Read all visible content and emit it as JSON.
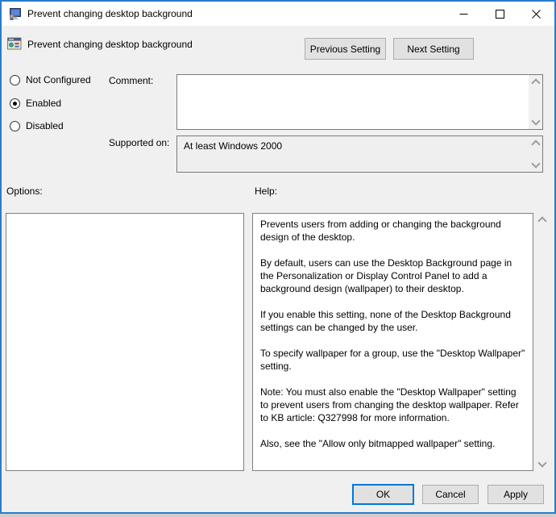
{
  "titlebar": {
    "title": "Prevent changing desktop background"
  },
  "header": {
    "title": "Prevent changing desktop background",
    "previous_button": "Previous Setting",
    "next_button": "Next Setting"
  },
  "state": {
    "not_configured": "Not Configured",
    "enabled": "Enabled",
    "disabled": "Disabled",
    "selected": "Enabled"
  },
  "comment": {
    "label": "Comment:",
    "value": ""
  },
  "supported_on": {
    "label": "Supported on:",
    "value": "At least Windows 2000"
  },
  "options_panel": {
    "label": "Options:"
  },
  "help_panel": {
    "label": "Help:",
    "paragraphs": [
      "Prevents users from adding or changing the background design of the desktop.",
      "By default, users can use the Desktop Background page in the Personalization or Display Control Panel to add a background design (wallpaper) to their desktop.",
      "If you enable this setting, none of the Desktop Background settings can be changed by the user.",
      "To specify wallpaper for a group, use the \"Desktop Wallpaper\" setting.",
      "Note: You must also enable the \"Desktop Wallpaper\" setting to prevent users from changing the desktop wallpaper. Refer to KB article: Q327998 for more information.",
      "Also, see the \"Allow only bitmapped wallpaper\" setting."
    ]
  },
  "footer": {
    "ok": "OK",
    "cancel": "Cancel",
    "apply": "Apply"
  },
  "colors": {
    "accent": "#0078d7",
    "window_border": "#2a7cc9",
    "dialog_bg": "#f0f0f0"
  }
}
